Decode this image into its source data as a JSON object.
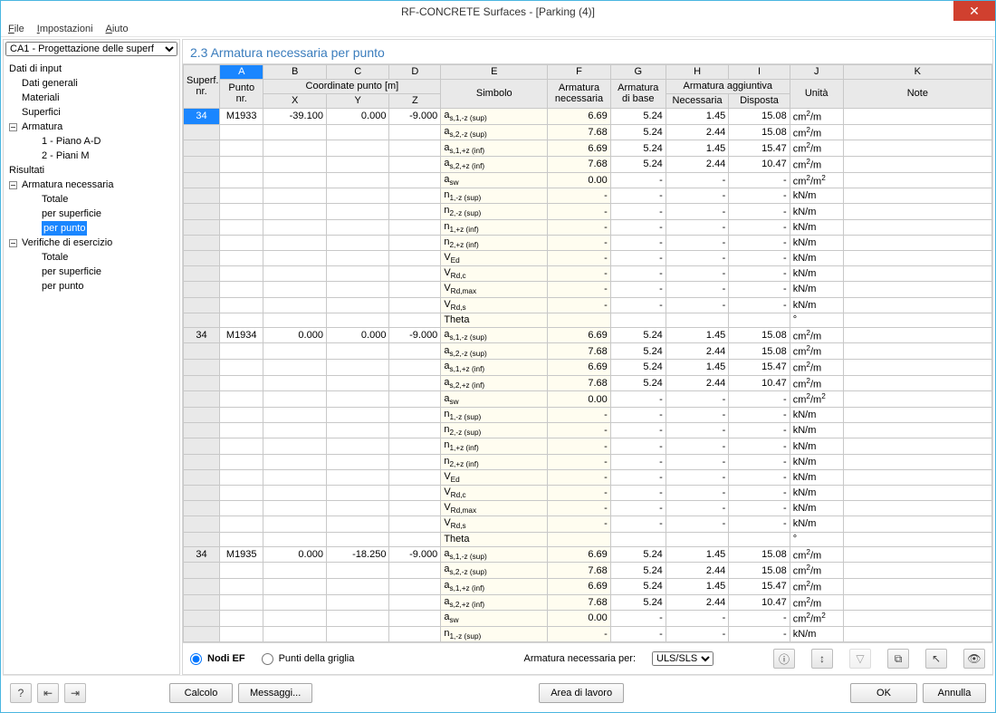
{
  "window": {
    "title": "RF-CONCRETE Surfaces - [Parking (4)]"
  },
  "menu": {
    "file": "File",
    "settings": "Impostazioni",
    "help": "Aiuto"
  },
  "sidebar": {
    "case": "CA1 - Progettazione delle superf",
    "items": {
      "input": "Dati di input",
      "general": "Dati generali",
      "materials": "Materiali",
      "surfaces": "Superfici",
      "reinf": "Armatura",
      "reinf1": "1 - Piano A-D",
      "reinf2": "2 - Piani M",
      "results": "Risultati",
      "reqreinf": "Armatura necessaria",
      "total": "Totale",
      "bysurf": "per superficie",
      "bypoint": "per punto",
      "serv": "Verifiche di esercizio",
      "stotal": "Totale",
      "sbysurf": "per superficie",
      "sbypoint": "per punto"
    }
  },
  "main": {
    "title": "2.3 Armatura necessaria per punto",
    "abc": [
      "A",
      "B",
      "C",
      "D",
      "E",
      "F",
      "G",
      "H",
      "I",
      "J",
      "K"
    ],
    "headers": {
      "surf": "Superf.",
      "nr": "nr.",
      "point": "Punto",
      "coord": "Coordinate punto [m]",
      "x": "X",
      "y": "Y",
      "z": "Z",
      "sym": "Simbolo",
      "req": "Armatura",
      "req2": "necessaria",
      "base": "Armatura",
      "base2": "di base",
      "add": "Armatura aggiuntiva",
      "addreq": "Necessaria",
      "addprov": "Disposta",
      "unit": "Unità",
      "note": "Note"
    },
    "blocks": [
      {
        "surf": "34",
        "point": "M1933",
        "x": "-39.100",
        "y": "0.000",
        "z": "-9.000"
      },
      {
        "surf": "34",
        "point": "M1934",
        "x": "0.000",
        "y": "0.000",
        "z": "-9.000"
      },
      {
        "surf": "34",
        "point": "M1935",
        "x": "0.000",
        "y": "-18.250",
        "z": "-9.000"
      }
    ],
    "rowsPattern": [
      {
        "sym": "a<sub>s,1,-z (sup)</sub>",
        "nec": "6.69",
        "base": "5.24",
        "addr": "1.45",
        "addp": "15.08",
        "unit": "cm<sup>2</sup>/m"
      },
      {
        "sym": "a<sub>s,2,-z (sup)</sub>",
        "nec": "7.68",
        "base": "5.24",
        "addr": "2.44",
        "addp": "15.08",
        "unit": "cm<sup>2</sup>/m"
      },
      {
        "sym": "a<sub>s,1,+z (inf)</sub>",
        "nec": "6.69",
        "base": "5.24",
        "addr": "1.45",
        "addp": "15.47",
        "unit": "cm<sup>2</sup>/m"
      },
      {
        "sym": "a<sub>s,2,+z (inf)</sub>",
        "nec": "7.68",
        "base": "5.24",
        "addr": "2.44",
        "addp": "10.47",
        "unit": "cm<sup>2</sup>/m"
      },
      {
        "sym": "a<sub>sw</sub>",
        "nec": "0.00",
        "base": "-",
        "addr": "-",
        "addp": "-",
        "unit": "cm<sup>2</sup>/m<sup>2</sup>"
      },
      {
        "sym": "n<sub>1,-z (sup)</sub>",
        "nec": "-",
        "base": "-",
        "addr": "-",
        "addp": "-",
        "unit": "kN/m"
      },
      {
        "sym": "n<sub>2,-z (sup)</sub>",
        "nec": "-",
        "base": "-",
        "addr": "-",
        "addp": "-",
        "unit": "kN/m"
      },
      {
        "sym": "n<sub>1,+z (inf)</sub>",
        "nec": "-",
        "base": "-",
        "addr": "-",
        "addp": "-",
        "unit": "kN/m"
      },
      {
        "sym": "n<sub>2,+z (inf)</sub>",
        "nec": "-",
        "base": "-",
        "addr": "-",
        "addp": "-",
        "unit": "kN/m"
      },
      {
        "sym": "V<sub>Ed</sub>",
        "nec": "-",
        "base": "-",
        "addr": "-",
        "addp": "-",
        "unit": "kN/m"
      },
      {
        "sym": "V<sub>Rd,c</sub>",
        "nec": "-",
        "base": "-",
        "addr": "-",
        "addp": "-",
        "unit": "kN/m"
      },
      {
        "sym": "V<sub>Rd,max</sub>",
        "nec": "-",
        "base": "-",
        "addr": "-",
        "addp": "-",
        "unit": "kN/m"
      },
      {
        "sym": "V<sub>Rd,s</sub>",
        "nec": "-",
        "base": "-",
        "addr": "-",
        "addp": "-",
        "unit": "kN/m"
      },
      {
        "sym": "Theta",
        "nec": "",
        "base": "",
        "addr": "",
        "addp": "",
        "unit": "°"
      }
    ],
    "lastBlockRows": 6
  },
  "gridfoot": {
    "radio1": "Nodi EF",
    "radio2": "Punti della griglia",
    "label": "Armatura necessaria per:",
    "combo": "ULS/SLS"
  },
  "footer": {
    "calc": "Calcolo",
    "msg": "Messaggi...",
    "work": "Area di lavoro",
    "ok": "OK",
    "cancel": "Annulla"
  }
}
